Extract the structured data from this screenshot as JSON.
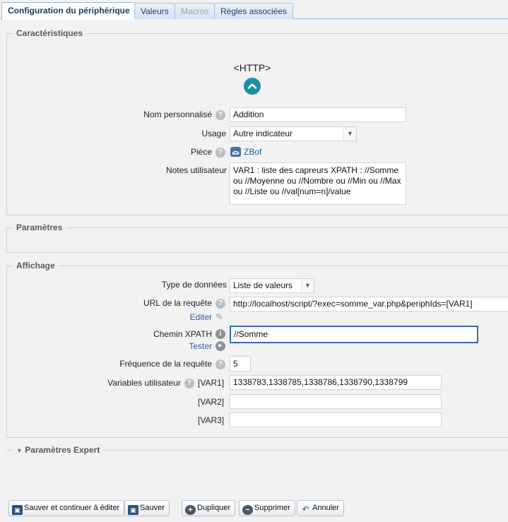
{
  "tabs": [
    {
      "label": "Configuration du périphérique",
      "state": "active"
    },
    {
      "label": "Valeurs",
      "state": "normal"
    },
    {
      "label": "Macros",
      "state": "disabled"
    },
    {
      "label": "Règles associées",
      "state": "normal"
    }
  ],
  "caracteristiques": {
    "legend": "Caractéristiques",
    "device_type": "<HTTP>",
    "nom_label": "Nom personnalisé",
    "nom_value": "Addition",
    "usage_label": "Usage",
    "usage_value": "Autre indicateur",
    "piece_label": "Pièce",
    "piece_value": "ZBof",
    "notes_label": "Notes utilisateur",
    "notes_value": "VAR1 : liste des capreurs XPATH : //Somme ou //Moyenne ou //Nombre ou //Min ou //Max ou //Liste ou //val[num=n]/value"
  },
  "parametres": {
    "legend": "Paramètres"
  },
  "affichage": {
    "legend": "Affichage",
    "type_label": "Type de données",
    "type_value": "Liste de valeurs",
    "url_label": "URL de la requête",
    "url_value": "http://localhost/script/?exec=somme_var.php&periphIds=[VAR1]",
    "editer_link": "Editer",
    "xpath_label": "Chemin XPATH",
    "xpath_value": "//Somme",
    "tester_link": "Tester",
    "freq_label": "Fréquence de la requête",
    "freq_value": "5",
    "vars_label": "Variables utilisateur",
    "vars": [
      {
        "name": "[VAR1]",
        "value": "1338783,1338785,1338786,1338790,1338799"
      },
      {
        "name": "[VAR2]",
        "value": ""
      },
      {
        "name": "[VAR3]",
        "value": ""
      }
    ]
  },
  "expert": {
    "legend": "Paramètres Expert"
  },
  "buttons": {
    "save_continue": "Sauver et continuer à éditer",
    "save": "Sauver",
    "duplicate": "Dupliquer",
    "delete": "Supprimer",
    "cancel": "Annuler"
  },
  "colors": {
    "tab_border": "#9fb8d8",
    "link": "#2b5ea7",
    "accent_icon": "#1a8fa6",
    "focus_border": "#3b67a8"
  }
}
